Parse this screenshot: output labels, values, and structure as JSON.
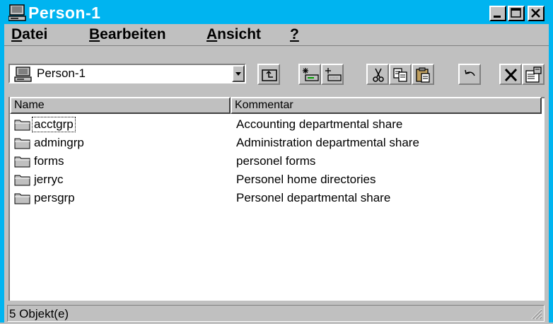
{
  "window": {
    "title": "Person-1"
  },
  "menu": {
    "items": [
      {
        "accel": "D",
        "rest": "atei"
      },
      {
        "accel": "B",
        "rest": "earbeiten"
      },
      {
        "accel": "A",
        "rest": "nsicht"
      },
      {
        "accel": "?",
        "rest": ""
      }
    ]
  },
  "toolbar": {
    "address_value": "Person-1"
  },
  "list": {
    "columns": [
      "Name",
      "Kommentar"
    ],
    "rows": [
      {
        "name": "acctgrp",
        "comment": "Accounting departmental share"
      },
      {
        "name": "admingrp",
        "comment": "Administration departmental share"
      },
      {
        "name": "forms",
        "comment": "personel forms"
      },
      {
        "name": "jerryc",
        "comment": "Personel home directories"
      },
      {
        "name": "persgrp",
        "comment": "Personel departmental share"
      }
    ]
  },
  "status": {
    "text": "5 Objekt(e)"
  },
  "colors": {
    "title_bar": "#00b4f0",
    "face": "#c0c0c0"
  }
}
